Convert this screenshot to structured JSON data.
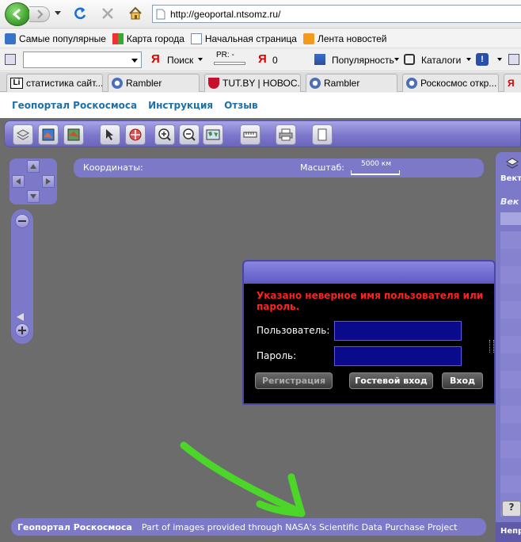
{
  "browser": {
    "url": "http://geoportal.ntsomz.ru/",
    "bookmarks": [
      {
        "label": "Самые популярные",
        "icon": "bookmark-popular-icon"
      },
      {
        "label": "Карта города",
        "icon": "map-icon"
      },
      {
        "label": "Начальная страница",
        "icon": "page-icon"
      },
      {
        "label": "Лента новостей",
        "icon": "rss-icon"
      }
    ],
    "yandex_bar": {
      "search_label": "Поиск",
      "pr_label": "PR: -",
      "counter": "0",
      "popularity_label": "Популярность",
      "catalogs_label": "Каталоги"
    },
    "tabs": [
      {
        "label": "статистика сайт...",
        "icon": "li-icon"
      },
      {
        "label": "Rambler",
        "icon": "rambler-icon"
      },
      {
        "label": "TUT.BY | НОВОС...",
        "icon": "tutby-icon"
      },
      {
        "label": "Rambler",
        "icon": "rambler-icon"
      },
      {
        "label": "Роскосмос откр...",
        "icon": "rambler-icon"
      }
    ]
  },
  "page": {
    "nav": [
      "Геопортал Роскосмоса",
      "Инструкция",
      "Отзыв"
    ],
    "coords_label": "Координаты:",
    "scale_label": "Масштаб:",
    "scale_value": "5000 км",
    "right_panel": {
      "header": "Вект",
      "subtitle": "Век",
      "bottom": "Непр"
    },
    "footer_title": "Геопортал Роскосмоса",
    "footer_note": "Part of images provided through NASA's Scientific Data Purchase Project"
  },
  "login": {
    "error": "Указано неверное имя пользователя или пароль.",
    "user_label": "Пользователь:",
    "user_value": "",
    "password_label": "Пароль:",
    "password_value": "",
    "register_label": "Регистрация",
    "guest_label": "Гостевой вход",
    "login_label": "Вход"
  },
  "colors": {
    "panel": "#7d79c9",
    "error": "#ff2020",
    "annotation_arrow": "#4cd62a"
  }
}
